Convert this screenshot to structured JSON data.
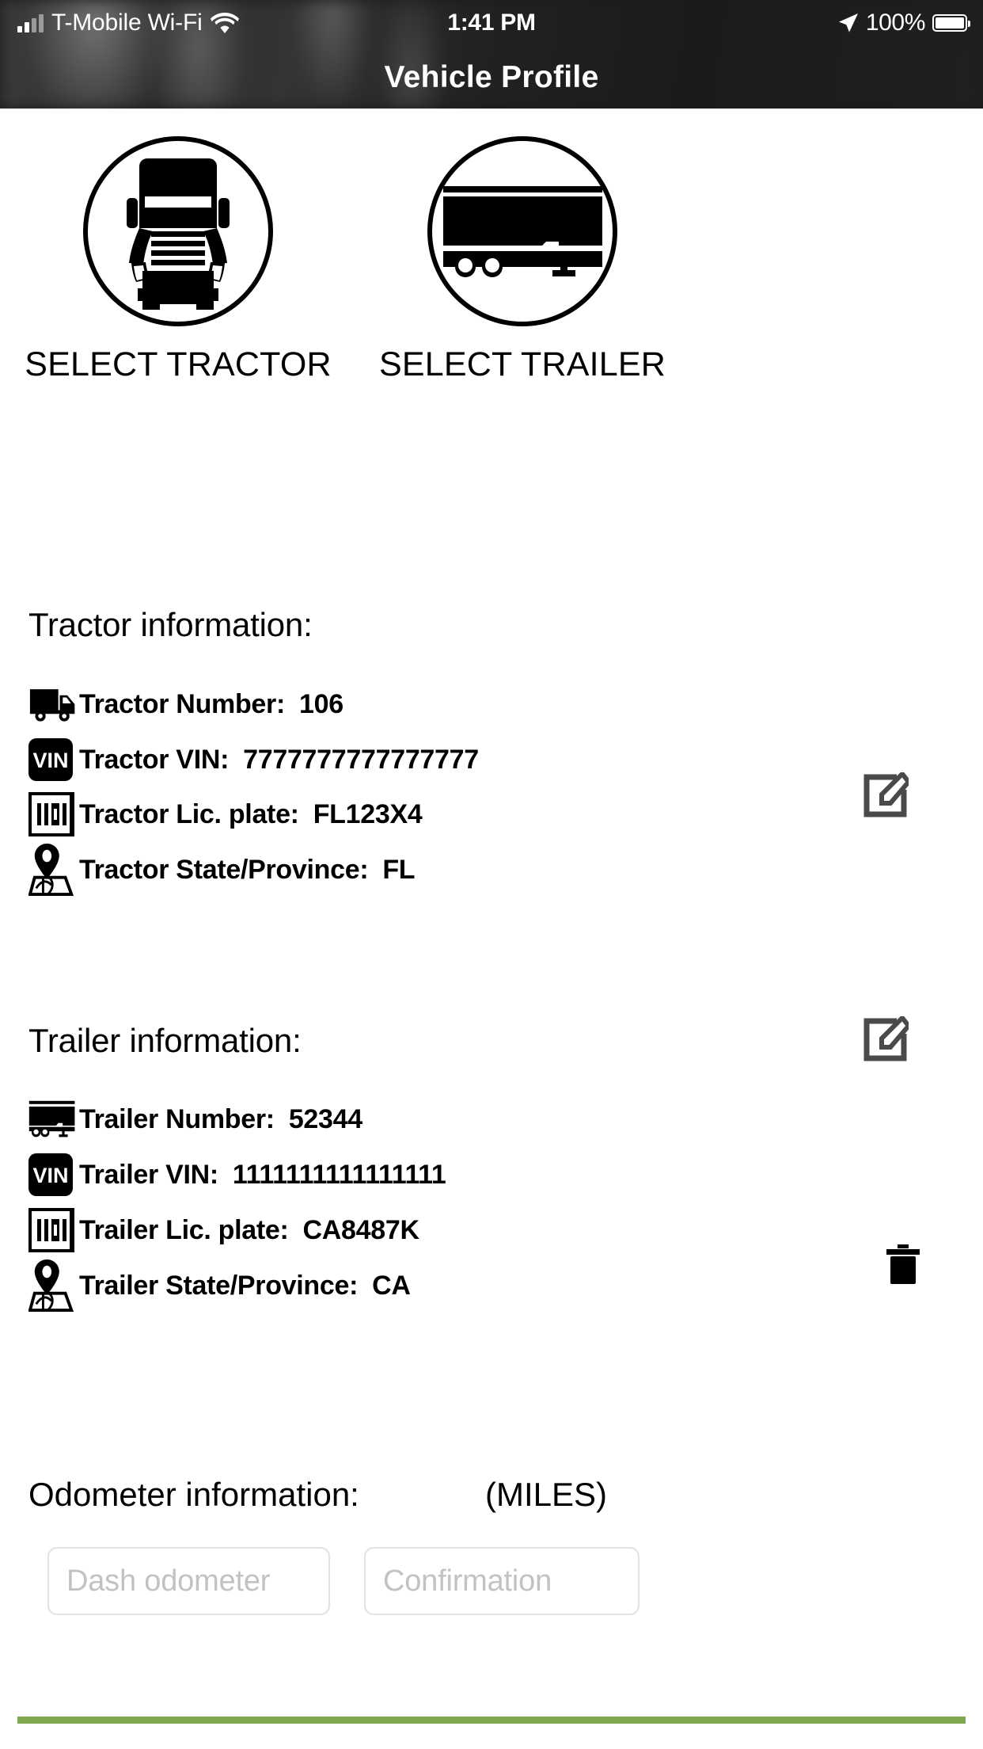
{
  "status_bar": {
    "carrier": "T-Mobile Wi-Fi",
    "wifi_icon": "wifi-icon",
    "signal_icon": "signal-bars-icon",
    "time": "1:41 PM",
    "location_icon": "location-arrow-icon",
    "battery_percent": "100%",
    "battery_icon": "battery-full-icon"
  },
  "header": {
    "title": "Vehicle Profile"
  },
  "selectors": [
    {
      "label": "SELECT TRACTOR",
      "icon": "tractor-front-icon"
    },
    {
      "label": "SELECT TRAILER",
      "icon": "trailer-side-icon"
    }
  ],
  "tractor": {
    "heading": "Tractor information:",
    "edit_icon": "edit-pencil-icon",
    "rows": [
      {
        "icon": "truck-icon",
        "label": "Tractor Number:",
        "value": "106"
      },
      {
        "icon": "vin-badge-icon",
        "label": "Tractor VIN:",
        "value": "7777777777777777"
      },
      {
        "icon": "license-plate-icon",
        "label": "Tractor Lic. plate:",
        "value": "FL123X4"
      },
      {
        "icon": "map-pin-icon",
        "label": "Tractor State/Province:",
        "value": "FL"
      }
    ]
  },
  "trailer": {
    "heading": "Trailer information:",
    "edit_icon": "edit-pencil-icon",
    "delete_icon": "trash-icon",
    "rows": [
      {
        "icon": "trailer-icon",
        "label": "Trailer Number:",
        "value": "52344"
      },
      {
        "icon": "vin-badge-icon",
        "label": "Trailer VIN:",
        "value": "1111111111111111"
      },
      {
        "icon": "license-plate-icon",
        "label": "Trailer Lic. plate:",
        "value": "CA8487K"
      },
      {
        "icon": "map-pin-icon",
        "label": "Trailer State/Province:",
        "value": "CA"
      }
    ]
  },
  "odometer": {
    "heading": "Odometer information:",
    "unit": "(MILES)",
    "dash_placeholder": "Dash odometer",
    "dash_value": "",
    "confirm_placeholder": "Confirmation",
    "confirm_value": ""
  },
  "colors": {
    "header_bg": "#1c1c1c",
    "accent_green": "#7fa84f",
    "text": "#000000",
    "placeholder": "#c2c2c2",
    "edit_icon": "#4a4a4a",
    "field_border": "#e2e2e2"
  }
}
